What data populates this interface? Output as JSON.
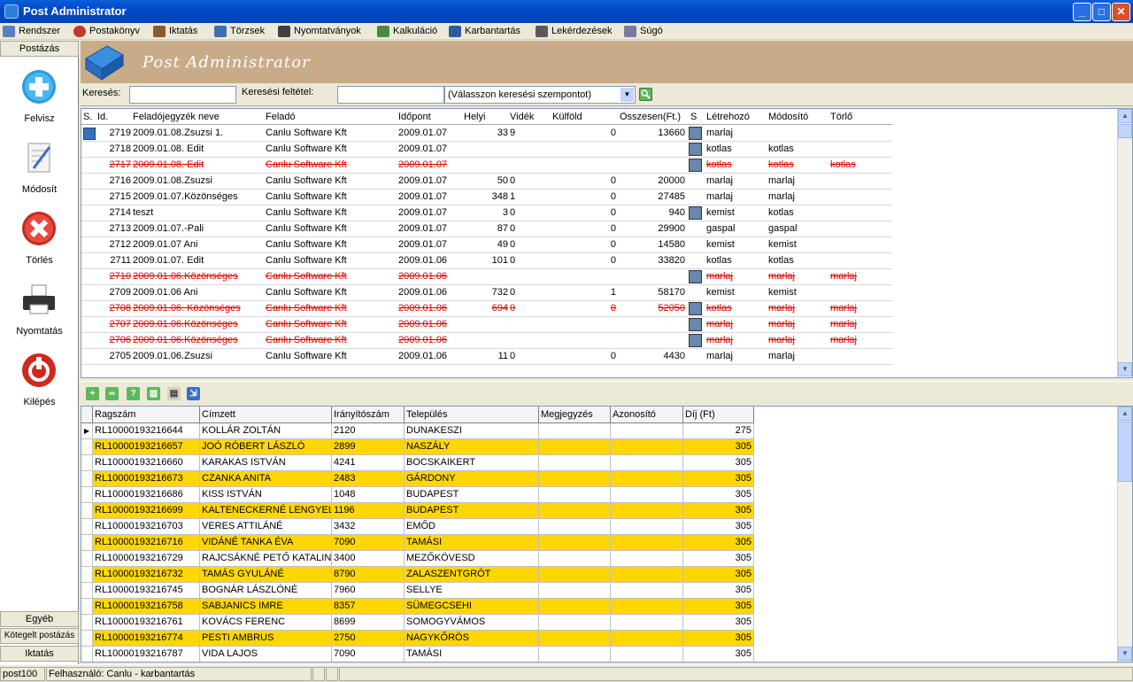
{
  "window": {
    "title": "Post Administrator"
  },
  "menu": [
    "Rendszer",
    "Postakönyv",
    "Iktatás",
    "Törzsek",
    "Nyomtatványok",
    "Kalkuláció",
    "Karbantartás",
    "Lekérdezések",
    "Súgó"
  ],
  "sidebar": {
    "header": "Postázás",
    "buttons": [
      {
        "label": "Felvisz",
        "icon": "add-icon"
      },
      {
        "label": "Módosít",
        "icon": "edit-icon"
      },
      {
        "label": "Törlés",
        "icon": "delete-icon"
      },
      {
        "label": "Nyomtatás",
        "icon": "printer-icon"
      },
      {
        "label": "Kilépés",
        "icon": "power-icon"
      }
    ],
    "bottom": [
      "Egyéb",
      "Kötegelt postázás",
      "Iktatás"
    ]
  },
  "banner": {
    "title": "Post Administrator"
  },
  "search": {
    "label": "Keresés:",
    "value": "",
    "criteria_label": "Keresési feltétel:",
    "criteria_value": "",
    "select_value": "(Válasszon keresési szempontot)"
  },
  "grid1": {
    "headers": [
      "S.",
      "Id.",
      "Feladójegyzék neve",
      "Feladó",
      "Időpont",
      "Helyi",
      "Vidék",
      "Külföld",
      "Összesen(Ft.)",
      "S",
      "Létrehozó",
      "Módosító",
      "Törlő"
    ],
    "rows": [
      {
        "id": "2719",
        "name": "2009.01.08.Zsuzsi 1.",
        "sender": "Canlu Software Kft",
        "date": "2009.01.07",
        "local": "33",
        "rural": "9",
        "foreign": "0",
        "total": "13660",
        "icon": true,
        "created": "marlaj",
        "modified": "",
        "deleted": "",
        "del": false,
        "sel": true
      },
      {
        "id": "2718",
        "name": "2009.01.08. Edit",
        "sender": "Canlu Software Kft",
        "date": "2009.01.07",
        "local": "",
        "rural": "",
        "foreign": "",
        "total": "",
        "icon": true,
        "created": "kotlas",
        "modified": "kotlas",
        "deleted": "",
        "del": false
      },
      {
        "id": "2717",
        "name": "2009.01.08. Edit",
        "sender": "Canlu Software Kft",
        "date": "2009.01.07",
        "local": "",
        "rural": "",
        "foreign": "",
        "total": "",
        "icon": true,
        "created": "kotlas",
        "modified": "kotlas",
        "deleted": "kotlas",
        "del": true
      },
      {
        "id": "2716",
        "name": "2009.01.08.Zsuzsi",
        "sender": "Canlu Software Kft",
        "date": "2009.01.07",
        "local": "50",
        "rural": "0",
        "foreign": "0",
        "total": "20000",
        "icon": false,
        "created": "marlaj",
        "modified": "marlaj",
        "deleted": "",
        "del": false
      },
      {
        "id": "2715",
        "name": "2009.01.07.Közönséges",
        "sender": "Canlu Software Kft",
        "date": "2009.01.07",
        "local": "348",
        "rural": "1",
        "foreign": "0",
        "total": "27485",
        "icon": false,
        "created": "marlaj",
        "modified": "marlaj",
        "deleted": "",
        "del": false
      },
      {
        "id": "2714",
        "name": "teszt",
        "sender": "Canlu Software Kft",
        "date": "2009.01.07",
        "local": "3",
        "rural": "0",
        "foreign": "0",
        "total": "940",
        "icon": true,
        "created": "kemist",
        "modified": "kotlas",
        "deleted": "",
        "del": false
      },
      {
        "id": "2713",
        "name": "2009.01.07.-Pali",
        "sender": "Canlu Software Kft",
        "date": "2009.01.07",
        "local": "87",
        "rural": "0",
        "foreign": "0",
        "total": "29900",
        "icon": false,
        "created": "gaspal",
        "modified": "gaspal",
        "deleted": "",
        "del": false
      },
      {
        "id": "2712",
        "name": "2009.01.07 Ani",
        "sender": "Canlu Software Kft",
        "date": "2009.01.07",
        "local": "49",
        "rural": "0",
        "foreign": "0",
        "total": "14580",
        "icon": false,
        "created": "kemist",
        "modified": "kemist",
        "deleted": "",
        "del": false
      },
      {
        "id": "2711",
        "name": "2009.01.07. Edit",
        "sender": "Canlu Software Kft",
        "date": "2009.01.06",
        "local": "101",
        "rural": "0",
        "foreign": "0",
        "total": "33820",
        "icon": false,
        "created": "kotlas",
        "modified": "kotlas",
        "deleted": "",
        "del": false
      },
      {
        "id": "2710",
        "name": "2009.01.06.Közönséges",
        "sender": "Canlu Software Kft",
        "date": "2009.01.06",
        "local": "",
        "rural": "",
        "foreign": "",
        "total": "",
        "icon": true,
        "created": "marlaj",
        "modified": "marlaj",
        "deleted": "marlaj",
        "del": true
      },
      {
        "id": "2709",
        "name": "2009.01.06 Ani",
        "sender": "Canlu Software Kft",
        "date": "2009.01.06",
        "local": "732",
        "rural": "0",
        "foreign": "1",
        "total": "58170",
        "icon": false,
        "created": "kemist",
        "modified": "kemist",
        "deleted": "",
        "del": false
      },
      {
        "id": "2708",
        "name": "2009.01.06. Közönséges",
        "sender": "Canlu Software Kft",
        "date": "2009.01.06",
        "local": "694",
        "rural": "0",
        "foreign": "0",
        "total": "52050",
        "icon": true,
        "created": "kotlas",
        "modified": "marlaj",
        "deleted": "marlaj",
        "del": true
      },
      {
        "id": "2707",
        "name": "2009.01.06.Közönséges",
        "sender": "Canlu Software Kft",
        "date": "2009.01.06",
        "local": "",
        "rural": "",
        "foreign": "",
        "total": "",
        "icon": true,
        "created": "marlaj",
        "modified": "marlaj",
        "deleted": "marlaj",
        "del": true
      },
      {
        "id": "2706",
        "name": "2009.01.06.Közönséges",
        "sender": "Canlu Software Kft",
        "date": "2009.01.06",
        "local": "",
        "rural": "",
        "foreign": "",
        "total": "",
        "icon": true,
        "created": "marlaj",
        "modified": "marlaj",
        "deleted": "marlaj",
        "del": true
      },
      {
        "id": "2705",
        "name": "2009.01.06.Zsuzsi",
        "sender": "Canlu Software Kft",
        "date": "2009.01.06",
        "local": "11",
        "rural": "0",
        "foreign": "0",
        "total": "4430",
        "icon": false,
        "created": "marlaj",
        "modified": "marlaj",
        "deleted": "",
        "del": false
      }
    ]
  },
  "toolbar2": [
    "add-icon",
    "link-icon",
    "help-icon",
    "trash-icon",
    "print-icon",
    "export-icon"
  ],
  "grid2": {
    "headers": [
      "Ragszám",
      "Címzett",
      "Irányítószám",
      "Település",
      "Megjegyzés",
      "Azonosító",
      "Díj (Ft)"
    ],
    "rows": [
      [
        "RL10000193216644",
        "KOLLÁR ZOLTÁN",
        "2120",
        "DUNAKESZI",
        "",
        "",
        "275"
      ],
      [
        "RL10000193216657",
        "JOÓ RÓBERT LÁSZLÓ",
        "2899",
        "NASZÁLY",
        "",
        "",
        "305"
      ],
      [
        "RL10000193216660",
        "KARAKAS ISTVÁN",
        "4241",
        "BOCSKAIKERT",
        "",
        "",
        "305"
      ],
      [
        "RL10000193216673",
        "CZANKA ANITA",
        "2483",
        "GÁRDONY",
        "",
        "",
        "305"
      ],
      [
        "RL10000193216686",
        "KISS ISTVÁN",
        "1048",
        "BUDAPEST",
        "",
        "",
        "305"
      ],
      [
        "RL10000193216699",
        "KALTENECKERNÉ LENGYEL LILL",
        "1196",
        "BUDAPEST",
        "",
        "",
        "305"
      ],
      [
        "RL10000193216703",
        "VERES ATTILÁNÉ",
        "3432",
        "EMŐD",
        "",
        "",
        "305"
      ],
      [
        "RL10000193216716",
        "VIDÁNÉ TANKA ÉVA",
        "7090",
        "TAMÁSI",
        "",
        "",
        "305"
      ],
      [
        "RL10000193216729",
        "RAJCSÁKNÉ PETŐ KATALIN",
        "3400",
        "MEZŐKÖVESD",
        "",
        "",
        "305"
      ],
      [
        "RL10000193216732",
        "TAMÁS GYULÁNÉ",
        "8790",
        "ZALASZENTGRÓT",
        "",
        "",
        "305"
      ],
      [
        "RL10000193216745",
        "BOGNÁR LÁSZLÓNÉ",
        "7960",
        "SELLYE",
        "",
        "",
        "305"
      ],
      [
        "RL10000193216758",
        "SABJANICS IMRE",
        "8357",
        "SÜMEGCSEHI",
        "",
        "",
        "305"
      ],
      [
        "RL10000193216761",
        "KOVÁCS FERENC",
        "8699",
        "SOMOGYVÁMOS",
        "",
        "",
        "305"
      ],
      [
        "RL10000193216774",
        "PESTI AMBRUS",
        "2750",
        "NAGYKŐRÖS",
        "",
        "",
        "305"
      ],
      [
        "RL10000193216787",
        "VIDA LAJOS",
        "7090",
        "TAMÁSI",
        "",
        "",
        "305"
      ]
    ]
  },
  "status": {
    "db": "post100",
    "user": "Felhasználó: Canlu - karbantartás"
  }
}
